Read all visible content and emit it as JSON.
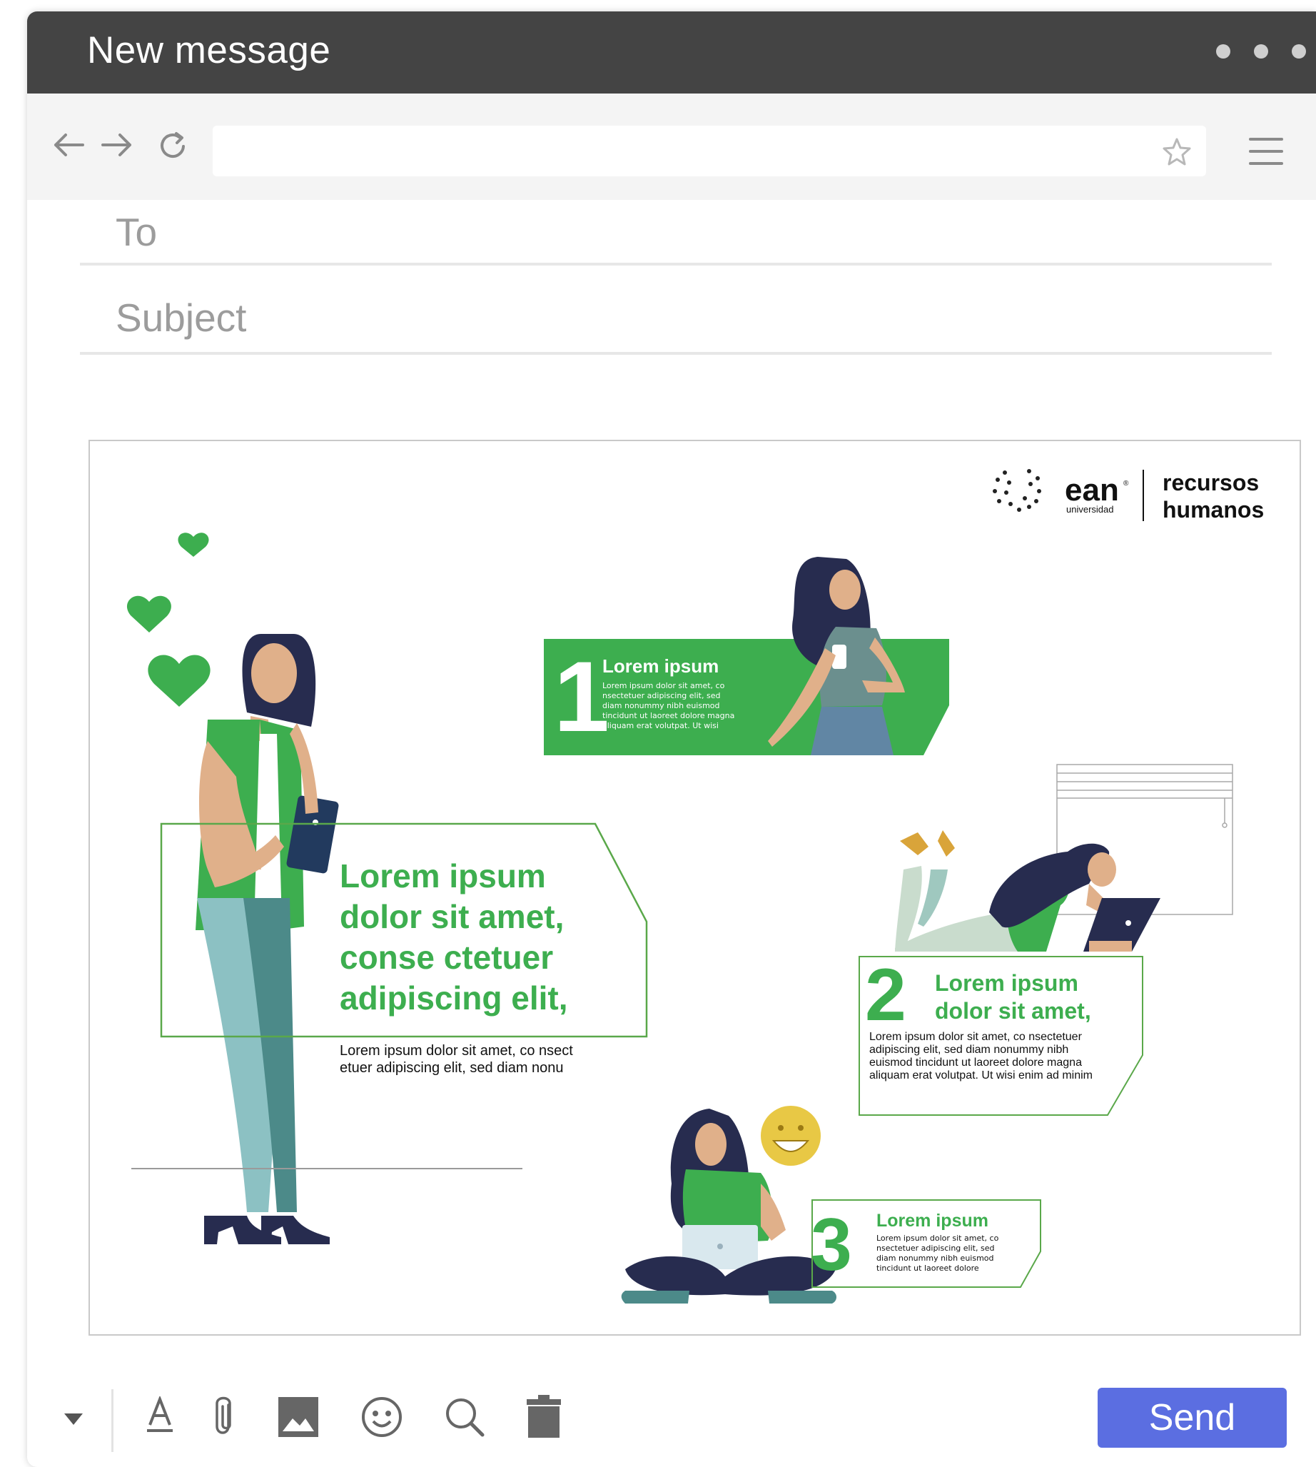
{
  "window": {
    "title": "New message"
  },
  "compose": {
    "to_label": "To",
    "subject_label": "Subject"
  },
  "banner": {
    "logo": {
      "brand": "ean",
      "sub": "universidad",
      "registered": "®",
      "line1": "recursos",
      "line2": "humanos"
    },
    "main": {
      "headline": [
        "Lorem ipsum",
        "dolor sit amet,",
        "conse ctetuer",
        "adipiscing elit,"
      ],
      "body": [
        "Lorem ipsum dolor sit amet, co nsect",
        "etuer adipiscing elit, sed diam nonu"
      ]
    },
    "step1": {
      "number": "1",
      "title": "Lorem ipsum",
      "text": [
        "Lorem ipsum dolor sit amet, co",
        "nsectetuer adipiscing elit, sed",
        "diam nonummy nibh euismod",
        "tincidunt ut laoreet dolore magna",
        "aliquam erat volutpat. Ut wisi"
      ]
    },
    "step2": {
      "number": "2",
      "title": [
        "Lorem ipsum",
        "dolor sit amet,"
      ],
      "text": [
        "Lorem ipsum dolor sit amet, co nsectetuer",
        "adipiscing elit, sed diam nonummy nibh",
        "euismod tincidunt ut laoreet dolore magna",
        "aliquam erat volutpat. Ut wisi enim ad minim"
      ]
    },
    "step3": {
      "number": "3",
      "title": "Lorem ipsum",
      "text": [
        "Lorem ipsum dolor sit amet, co",
        "nsectetuer adipiscing elit, sed",
        "diam nonummy nibh euismod",
        "tincidunt ut laoreet dolore"
      ]
    }
  },
  "bottom_bar": {
    "send_label": "Send"
  },
  "colors": {
    "titlebar": "#444444",
    "toolbar": "#f4f4f4",
    "send": "#5b6ee1",
    "green": "#3dae4f",
    "navy": "#272c4f"
  },
  "icons": [
    "back-arrow-icon",
    "forward-arrow-icon",
    "reload-icon",
    "star-icon",
    "hamburger-menu-icon",
    "dropdown-caret-icon",
    "text-format-icon",
    "paperclip-icon",
    "image-icon",
    "emoji-icon",
    "search-icon",
    "trash-icon"
  ]
}
